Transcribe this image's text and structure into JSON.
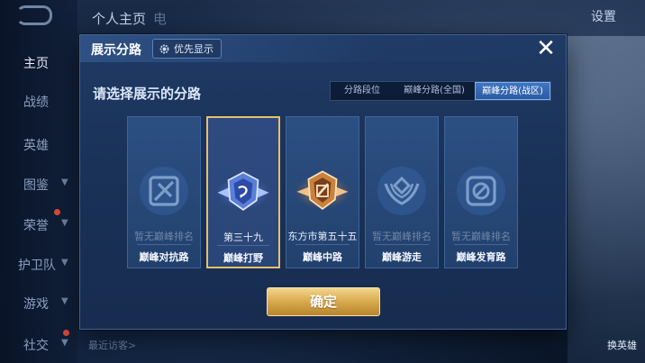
{
  "background": {
    "sidebar": [
      {
        "label": "主页",
        "active": true
      },
      {
        "label": "战绩"
      },
      {
        "label": "英雄"
      },
      {
        "label": "图鉴"
      },
      {
        "label": "荣誉"
      },
      {
        "label": "护卫队"
      },
      {
        "label": "游戏"
      },
      {
        "label": "社交"
      }
    ],
    "top_tab": "个人主页",
    "top_tab_2": "电",
    "settings_label": "设置",
    "recent_visitors": "最近访客>",
    "switch_hero": "换英雄"
  },
  "modal": {
    "title": "展示分路",
    "priority_label": "优先显示",
    "prompt": "请选择展示的分路",
    "tabs": [
      {
        "label": "分路段位"
      },
      {
        "label": "巅峰分路(全国)"
      },
      {
        "label": "巅峰分路(战区)",
        "selected": true
      }
    ],
    "cards": [
      {
        "rank": "暂无巅峰排名",
        "lane": "巅峰对抗路",
        "icon": "clash-lane-icon",
        "dim": true
      },
      {
        "rank": "第三十九",
        "lane": "巅峰打野",
        "icon": "jungle-emblem-icon",
        "selected": true
      },
      {
        "rank": "东方市第五十五",
        "lane": "巅峰中路",
        "icon": "mid-lane-emblem-icon"
      },
      {
        "rank": "暂无巅峰排名",
        "lane": "巅峰游走",
        "icon": "roam-lane-icon",
        "dim": true
      },
      {
        "rank": "暂无巅峰排名",
        "lane": "巅峰发育路",
        "icon": "farm-lane-icon",
        "dim": true
      }
    ],
    "confirm_label": "确定"
  },
  "colors": {
    "accent_gold": "#e6c06a",
    "panel_blue": "#1a3258",
    "tab_selected": "#3f77c4"
  }
}
